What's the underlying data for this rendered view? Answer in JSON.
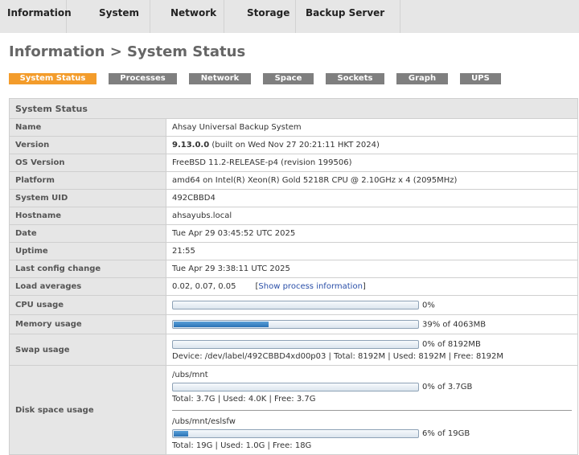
{
  "nav": [
    "Information",
    "System",
    "Network",
    "Storage",
    "Backup Server"
  ],
  "title": "Information > System Status",
  "subtabs": [
    "System Status",
    "Processes",
    "Network",
    "Space",
    "Sockets",
    "Graph",
    "UPS"
  ],
  "table": {
    "header": "System Status",
    "name": {
      "label": "Name",
      "value": "Ahsay Universal Backup System"
    },
    "version": {
      "label": "Version",
      "bold": "9.13.0.0",
      "rest": " (built on Wed Nov 27 20:21:11 HKT 2024)"
    },
    "os": {
      "label": "OS Version",
      "value": "FreeBSD 11.2-RELEASE-p4 (revision 199506)"
    },
    "platform": {
      "label": "Platform",
      "value": "amd64 on Intel(R) Xeon(R) Gold 5218R CPU @ 2.10GHz x 4 (2095MHz)"
    },
    "uid": {
      "label": "System UID",
      "value": "492CBBD4"
    },
    "hostname": {
      "label": "Hostname",
      "value": "ahsayubs.local"
    },
    "date": {
      "label": "Date",
      "value": "Tue Apr 29 03:45:52 UTC 2025"
    },
    "uptime": {
      "label": "Uptime",
      "value": "21:55"
    },
    "config": {
      "label": "Last config change",
      "value": "Tue Apr 29 3:38:11 UTC 2025"
    },
    "load": {
      "label": "Load averages",
      "value": "0.02, 0.07, 0.05",
      "link": "Show process information",
      "lb": "[",
      "rb": "]"
    },
    "cpu": {
      "label": "CPU usage",
      "percent": 0,
      "text": "0%"
    },
    "memory": {
      "label": "Memory usage",
      "percent": 39,
      "text": "39% of 4063MB"
    },
    "swap": {
      "label": "Swap usage",
      "percent": 0,
      "text": "0% of 8192MB",
      "device": "Device: /dev/label/492CBBD4xd00p03 | Total: 8192M | Used: 8192M | Free: 8192M"
    },
    "disk": {
      "label": "Disk space usage",
      "items": [
        {
          "path": "/ubs/mnt",
          "percent": 0,
          "text": "0% of 3.7GB",
          "details": "Total: 3.7G | Used: 4.0K | Free: 3.7G"
        },
        {
          "path": "/ubs/mnt/eslsfw",
          "percent": 6,
          "text": "6% of 19GB",
          "details": "Total: 19G | Used: 1.0G | Free: 18G"
        }
      ]
    }
  }
}
